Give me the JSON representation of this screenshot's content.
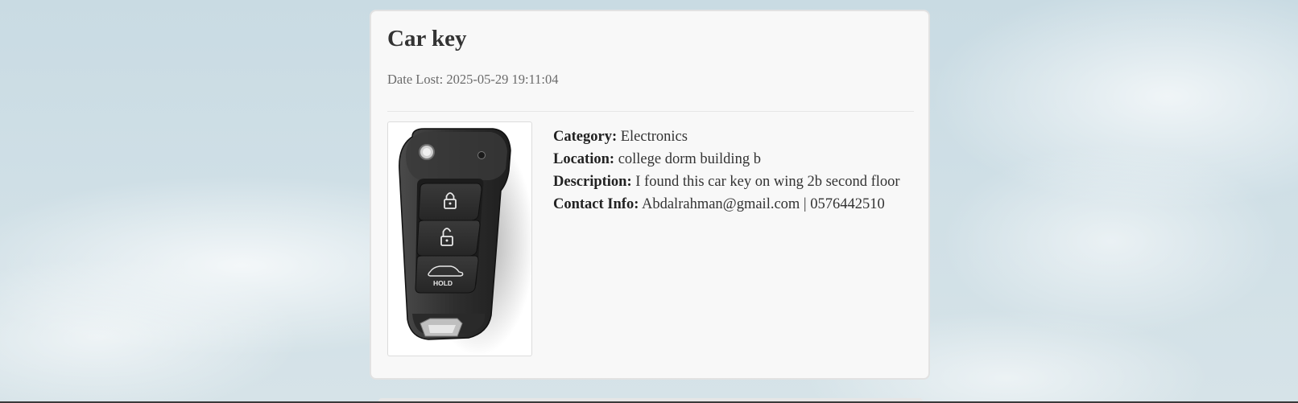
{
  "item": {
    "title": "Car key",
    "date_label": "Date Lost:",
    "date_value": "2025-05-29 19:11:04",
    "image_alt": "car-key-photo",
    "image_button_text": "HOLD",
    "details": [
      {
        "label": "Category:",
        "value": "Electronics"
      },
      {
        "label": "Location:",
        "value": "college dorm building b"
      },
      {
        "label": "Description:",
        "value": "I found this car key on wing 2b second floor"
      },
      {
        "label": "Contact Info:",
        "value": "Abdalrahman@gmail.com | 0576442510"
      }
    ]
  }
}
